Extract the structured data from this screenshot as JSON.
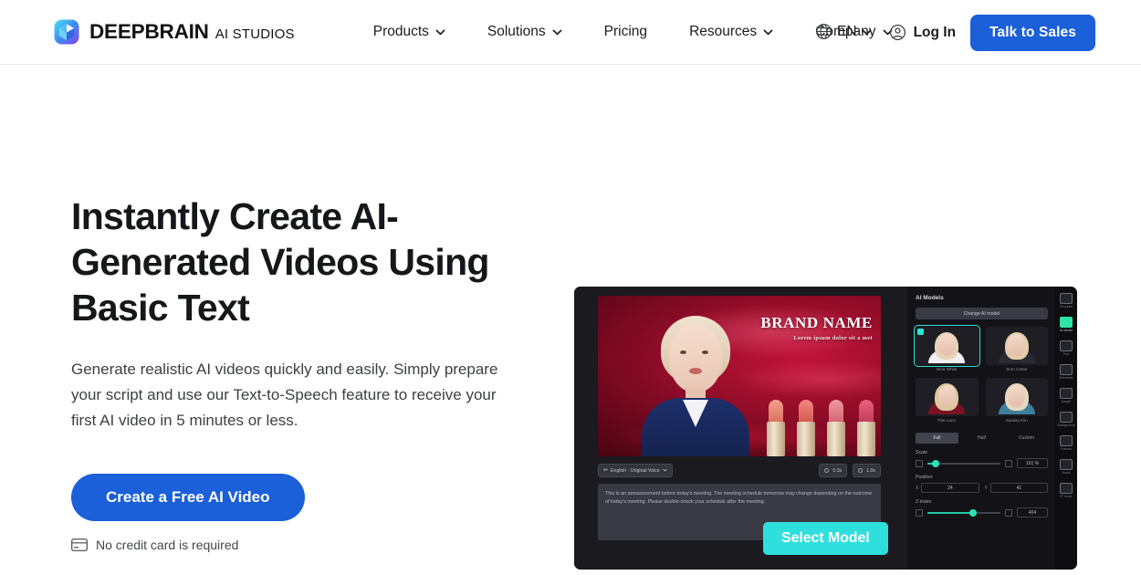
{
  "brand": {
    "name": "DEEPBRAIN",
    "product": "AI STUDIOS",
    "logo_icon": "cube-logo-icon"
  },
  "nav": {
    "items": [
      {
        "label": "Products",
        "has_dropdown": true,
        "icon": "chevron-down-icon"
      },
      {
        "label": "Solutions",
        "has_dropdown": true,
        "icon": "chevron-down-icon"
      },
      {
        "label": "Pricing",
        "has_dropdown": false,
        "icon": ""
      },
      {
        "label": "Resources",
        "has_dropdown": true,
        "icon": "chevron-down-icon"
      },
      {
        "label": "Company",
        "has_dropdown": true,
        "icon": "chevron-down-icon"
      }
    ]
  },
  "language": {
    "label": "EN",
    "globe_icon": "globe-icon",
    "chevron_icon": "chevron-down-icon"
  },
  "header_actions": {
    "login_label": "Log In",
    "login_icon": "user-circle-icon",
    "sales_label": "Talk to Sales"
  },
  "hero": {
    "headline": "Instantly Create AI-Generated Videos Using Basic Text",
    "subline": "Generate realistic AI videos quickly and easily. Simply prepare your script and use our Text-to-Speech feature to receive your first AI video in 5 minutes or less.",
    "cta_label": "Create a Free AI Video",
    "note": "No credit card is required",
    "note_icon": "credit-card-icon"
  },
  "mockup": {
    "overlay_button": "Select Model",
    "cursor_icon": "mouse-cursor-icon",
    "stage": {
      "brand_title": "BRAND NAME",
      "brand_sub": "Lorem ipsum dolor sit a met"
    },
    "voice_chip": {
      "icon": "voice-wave-icon",
      "label": "English - Original Voice",
      "trailing_icon": "chevron-down-icon"
    },
    "timing_chips": [
      {
        "icon": "clock-icon",
        "label": "0.3s"
      },
      {
        "icon": "clock-icon",
        "label": "1.0s"
      }
    ],
    "script_text": "This is an announcement before today's meeting. The meeting schedule tomorrow may change depending on the outcome of today's meeting. Please double-check your schedule after the meeting.",
    "panel": {
      "title": "AI Models",
      "change_button": "Change AI model",
      "models": [
        {
          "name": "Nina White",
          "selected": true,
          "hair": "#e7d4b6",
          "shirt": "#f0f0f2"
        },
        {
          "name": "Jenn Carter",
          "selected": false,
          "hair": "#e2cda9",
          "shirt": "#2a2a32"
        },
        {
          "name": "Rita Lane",
          "selected": false,
          "hair": "#dfc79f",
          "shirt": "#7b1224"
        },
        {
          "name": "Sandra Kim",
          "selected": false,
          "hair": "#e6d8c1",
          "shirt": "#3f7f9c"
        }
      ],
      "tabs": [
        {
          "label": "Full",
          "active": true
        },
        {
          "label": "Half",
          "active": false
        },
        {
          "label": "Custom",
          "active": false
        }
      ],
      "controls": {
        "scale": {
          "label": "Scale",
          "value": "101 %",
          "percent": 10
        },
        "position": {
          "label": "Position",
          "x_axis": "X",
          "x_value": "24",
          "y_axis": "Y",
          "y_value": "41"
        },
        "zindex": {
          "label": "Z-index",
          "value": "404",
          "percent": 60
        }
      }
    },
    "rail": [
      {
        "label": "Template",
        "icon": "template-icon",
        "active": false
      },
      {
        "label": "AI Model",
        "icon": "ai-model-icon",
        "active": true
      },
      {
        "label": "Text",
        "icon": "text-icon",
        "active": false
      },
      {
        "label": "Elements",
        "icon": "elements-icon",
        "active": false
      },
      {
        "label": "Image",
        "icon": "image-icon",
        "active": false
      },
      {
        "label": "Background",
        "icon": "background-icon",
        "active": false
      },
      {
        "label": "Frames",
        "icon": "frames-icon",
        "active": false
      },
      {
        "label": "Audio",
        "icon": "audio-icon",
        "active": false
      },
      {
        "label": "IP Voice",
        "icon": "ip-voice-icon",
        "active": false
      }
    ]
  },
  "colors": {
    "accent_blue": "#1b5fd9",
    "accent_cyan": "#2fdfdd",
    "accent_green": "#2fe3a8",
    "text_dark": "#16171a",
    "text_muted": "#3d3f45"
  }
}
